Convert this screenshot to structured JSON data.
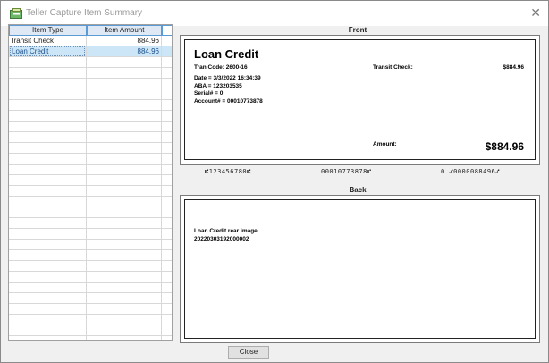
{
  "window": {
    "title": "Teller Capture Item Summary",
    "close_glyph": "✕"
  },
  "grid": {
    "headers": {
      "type": "Item Type",
      "amount": "Item Amount"
    },
    "rows": [
      {
        "type": "Transit Check",
        "amount": "884.96",
        "selected": false
      },
      {
        "type": "Loan Credit",
        "amount": "884.96",
        "selected": true
      }
    ],
    "empty_row_count": 28
  },
  "front": {
    "label": "Front",
    "title": "Loan Credit",
    "tran_code": "Tran Code: 2600-16",
    "date": "Date = 3/3/2022 16:34:39",
    "aba": "ABA = 123203535",
    "serial": "Serial# = 0",
    "account": "Account# = 00010773878",
    "transit_label": "Transit Check:",
    "transit_value": "$884.96",
    "amount_label": "Amount:",
    "amount_value": "$884.96"
  },
  "micr": {
    "routing": "⑆123456780⑆",
    "account": "00010773878⑈",
    "amount": "0 ⑇0000088496⑇"
  },
  "back": {
    "label": "Back",
    "line1": "Loan Credit rear image",
    "line2": "20220303192000002"
  },
  "footer": {
    "close_label": "Close"
  },
  "icons": {
    "app": "teller-capture-icon"
  }
}
